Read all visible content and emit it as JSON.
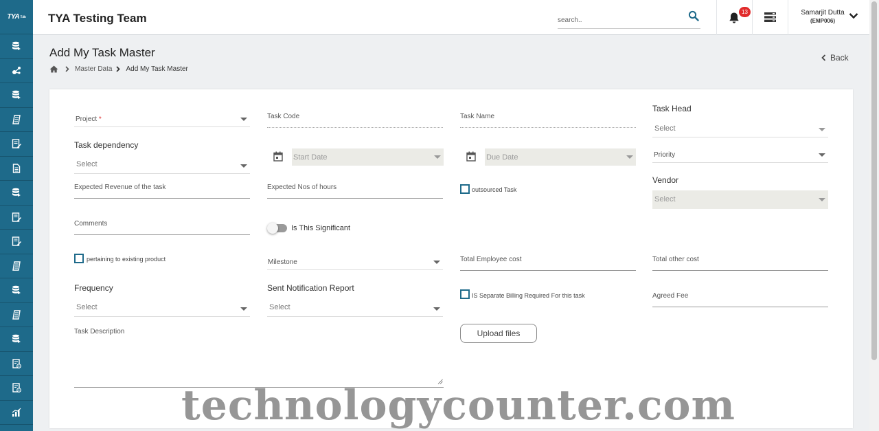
{
  "sidebar": {
    "logo": "TYA",
    "logo_sub": "Tuttu",
    "items": [
      {
        "icon": "database-icon"
      },
      {
        "icon": "network-icon"
      },
      {
        "icon": "database-icon"
      },
      {
        "icon": "ledger-icon"
      },
      {
        "icon": "document-edit-icon"
      },
      {
        "icon": "document-icon"
      },
      {
        "icon": "database-icon"
      },
      {
        "icon": "document-edit-icon"
      },
      {
        "icon": "document-edit-icon"
      },
      {
        "icon": "ledger-icon"
      },
      {
        "icon": "database-icon"
      },
      {
        "icon": "ledger-icon"
      },
      {
        "icon": "database-icon"
      },
      {
        "icon": "invoice-icon"
      },
      {
        "icon": "invoice-icon"
      },
      {
        "icon": "chart-icon"
      }
    ]
  },
  "header": {
    "title": "TYA Testing Team",
    "search_placeholder": "search..",
    "notification_count": "13",
    "user_name": "Samarjit Dutta",
    "user_code": "(EMP006)"
  },
  "page": {
    "title": "Add My Task Master",
    "breadcrumb": [
      "Master Data",
      "Add My Task Master"
    ],
    "back_label": "Back"
  },
  "form": {
    "project": {
      "label": "Project",
      "required_mark": "*"
    },
    "task_code": {
      "label": "Task Code"
    },
    "task_name": {
      "label": "Task Name"
    },
    "task_head": {
      "label": "Task Head",
      "placeholder": "Select"
    },
    "task_dependency": {
      "label": "Task dependency",
      "placeholder": "Select"
    },
    "start_date": {
      "placeholder": "Start Date"
    },
    "due_date": {
      "placeholder": "Due Date"
    },
    "priority": {
      "label": "Priority"
    },
    "expected_revenue": {
      "label": "Expected Revenue of the task"
    },
    "expected_hours": {
      "label": "Expected Nos of hours"
    },
    "outsourced": {
      "label": "outsourced Task"
    },
    "vendor": {
      "label": "Vendor",
      "placeholder": "Select"
    },
    "comments": {
      "label": "Comments"
    },
    "significant": {
      "label": "Is This Significant"
    },
    "pertaining": {
      "label": "pertaining to existing product"
    },
    "milestone": {
      "label": "Milestone"
    },
    "total_employee_cost": {
      "label": "Total Employee cost"
    },
    "total_other_cost": {
      "label": "Total other cost"
    },
    "frequency": {
      "label": "Frequency",
      "placeholder": "Select"
    },
    "sent_notification": {
      "label": "Sent Notification Report",
      "placeholder": "Select"
    },
    "separate_billing": {
      "label": "IS Separate Billing Required For this task"
    },
    "agreed_fee": {
      "label": "Agreed Fee"
    },
    "upload_label": "Upload files",
    "task_description": {
      "label": "Task Description"
    }
  },
  "watermark": "technologycounter.com",
  "colors": {
    "sidebar": "#1e6a8a",
    "badge": "#e12b2b"
  }
}
